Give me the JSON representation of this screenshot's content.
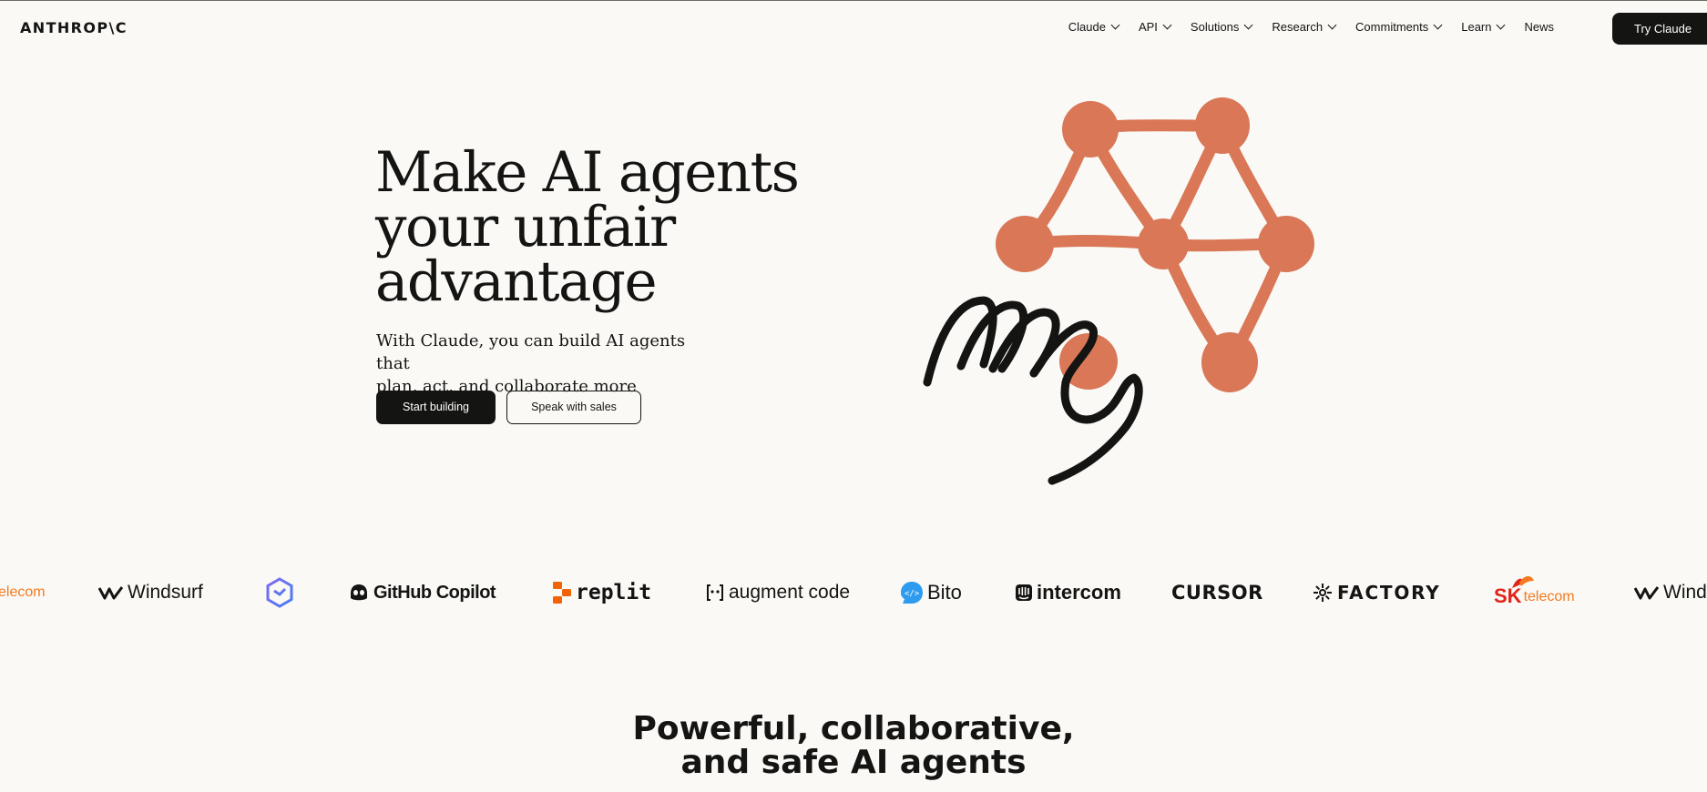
{
  "nav": {
    "logo": "ANTHROP\\C",
    "menu": [
      {
        "label": "Claude",
        "dropdown": true
      },
      {
        "label": "API",
        "dropdown": true
      },
      {
        "label": "Solutions",
        "dropdown": true
      },
      {
        "label": "Research",
        "dropdown": true
      },
      {
        "label": "Commitments",
        "dropdown": true
      },
      {
        "label": "Learn",
        "dropdown": true
      },
      {
        "label": "News",
        "dropdown": false
      }
    ],
    "cta": "Try Claude"
  },
  "hero": {
    "title_line1": "Make AI agents",
    "title_line2": "your unfair",
    "title_line3": "advantage",
    "subtitle_line1": "With Claude, you can build AI agents that",
    "subtitle_line2": "plan, act, and collaborate more effectively.",
    "primary_button": "Start building",
    "secondary_button": "Speak with sales",
    "illustration_icon": "hand-network-illustration-icon"
  },
  "logos": {
    "sk_partial_text": "elecom",
    "windsurf": "Windsurf",
    "github": "GitHub Copilot",
    "replit": "replit",
    "augment": "augment code",
    "bito": "Bito",
    "intercom": "intercom",
    "cursor": "CURSOR",
    "factory": "FACTORY",
    "sk": "SK",
    "telecom": "telecom",
    "windsurf_partial": "Wind"
  },
  "section": {
    "title_line1": "Powerful, collaborative,",
    "title_line2": "and safe AI agents"
  },
  "colors": {
    "background": "#faf9f5",
    "accent": "#d97757",
    "ink": "#141413",
    "sk_red": "#e2231a",
    "sk_orange": "#f47920"
  }
}
